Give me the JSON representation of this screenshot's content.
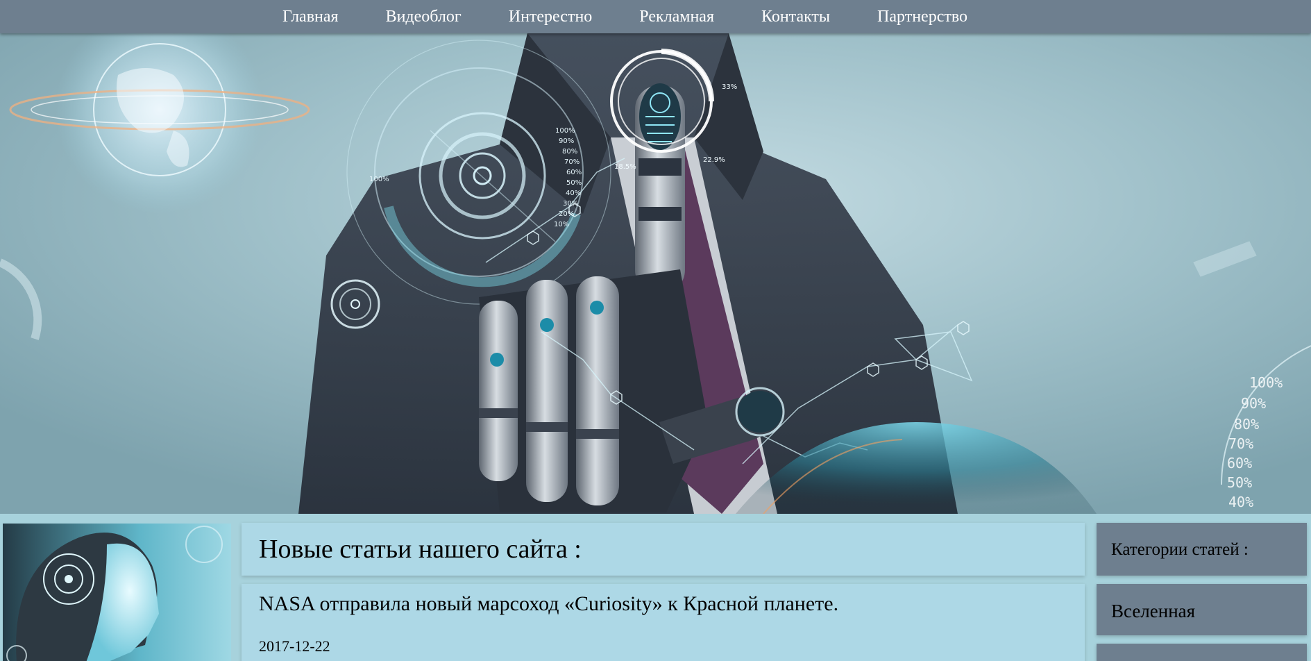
{
  "nav": {
    "items": [
      {
        "label": "Главная"
      },
      {
        "label": "Видеоблог"
      },
      {
        "label": "Интерестно"
      },
      {
        "label": "Рекламная"
      },
      {
        "label": "Контакты"
      },
      {
        "label": "Партнерство"
      }
    ]
  },
  "hero": {
    "hud_labels": [
      "100%",
      "90%",
      "80%",
      "70%",
      "60%",
      "50%",
      "40%",
      "30%",
      "20%",
      "10%"
    ],
    "side_labels": [
      "100%",
      "90%",
      "80%",
      "70%",
      "60%",
      "50%",
      "40%"
    ],
    "finger_label_1": "33%",
    "finger_label_2": "18.5%",
    "finger_label_3": "22.9%",
    "dial_label": "100%"
  },
  "main": {
    "title": "Новые статьи нашего сайта :",
    "articles": [
      {
        "headline": "NASA отправила новый марсоход «Curiosity» к Красной планете.",
        "date": "2017-12-22"
      }
    ]
  },
  "sidebar": {
    "title": "Категории статей :",
    "items": [
      {
        "label": "Вселенная"
      }
    ]
  },
  "colors": {
    "nav_bg": "#6e7f8f",
    "panel_bg": "#add8e6",
    "page_bg": "#a7d2dc"
  }
}
